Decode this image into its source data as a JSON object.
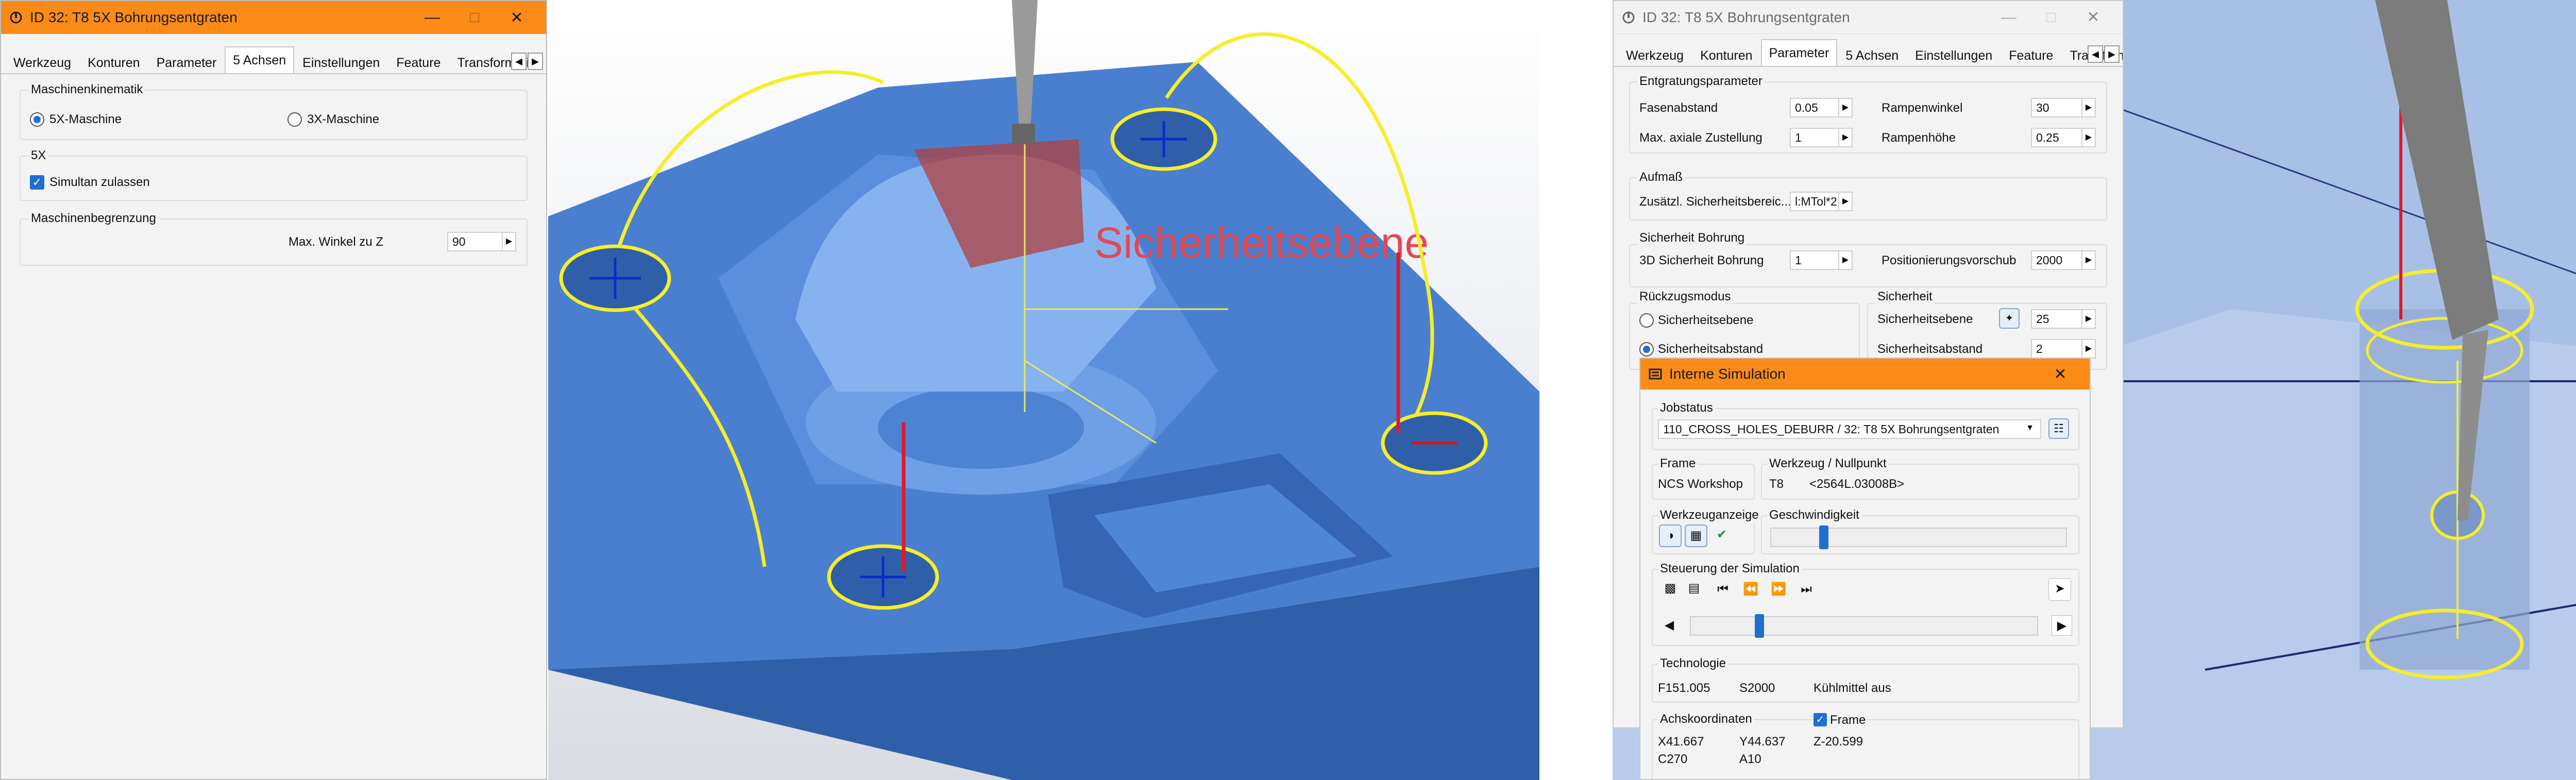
{
  "left_window": {
    "title": "ID 32: T8 5X Bohrungsentgraten",
    "tabs": [
      "Werkzeug",
      "Konturen",
      "Parameter",
      "5 Achsen",
      "Einstellungen",
      "Feature",
      "Transformatio"
    ],
    "active_tab": "5 Achsen",
    "kinematik": {
      "title": "Maschinenkinematik",
      "option_5x": "5X-Maschine",
      "option_3x": "3X-Maschine",
      "selected": "5X-Maschine"
    },
    "fivex": {
      "title": "5X",
      "simultan_label": "Simultan zulassen",
      "simultan_checked": true
    },
    "begrenzung": {
      "title": "Maschinenbegrenzung",
      "max_winkel_label": "Max. Winkel zu Z",
      "max_winkel_value": "90"
    }
  },
  "right_window": {
    "title": "ID 32: T8 5X Bohrungsentgraten",
    "tabs": [
      "Werkzeug",
      "Konturen",
      "Parameter",
      "5 Achsen",
      "Einstellungen",
      "Feature",
      "Transformati"
    ],
    "active_tab": "Parameter",
    "entgratung": {
      "title": "Entgratungsparameter",
      "fasenabstand_label": "Fasenabstand",
      "fasenabstand_value": "0.05",
      "rampenwinkel_label": "Rampenwinkel",
      "rampenwinkel_value": "30",
      "max_axiale_label": "Max. axiale Zustellung",
      "max_axiale_value": "1",
      "rampenhoehe_label": "Rampenhöhe",
      "rampenhoehe_value": "0.25"
    },
    "aufmass": {
      "title": "Aufmaß",
      "zus_label": "Zusätzl. Sicherheitsbereic...",
      "zus_value": "l:MTol*2"
    },
    "sicherheit_bohrung": {
      "title": "Sicherheit Bohrung",
      "sicherheit_label": "3D Sicherheit Bohrung",
      "sicherheit_value": "1",
      "vorschub_label": "Positionierungsvorschub",
      "vorschub_value": "2000"
    },
    "rueckzug": {
      "title": "Rückzugsmodus",
      "option_ebene": "Sicherheitsebene",
      "option_abstand": "Sicherheitsabstand",
      "selected": "Sicherheitsabstand"
    },
    "sicherheit": {
      "title": "Sicherheit",
      "ebene_label": "Sicherheitsebene",
      "ebene_value": "25",
      "abstand_label": "Sicherheitsabstand",
      "abstand_value": "2"
    }
  },
  "simulation": {
    "title": "Interne Simulation",
    "jobstatus_label": "Jobstatus",
    "jobstatus_value": "110_CROSS_HOLES_DEBURR / 32: T8 5X Bohrungsentgraten",
    "frame_label": "Frame",
    "frame_value": "NCS Workshop",
    "werkzeug_label": "Werkzeug / Nullpunkt",
    "werkzeug_value": "T8",
    "nullpunkt_value": "<2564L.03008B>",
    "werkzeuganzeige_label": "Werkzeuganzeige",
    "geschwindigkeit_label": "Geschwindigkeit",
    "geschwindigkeit_level": 0.18,
    "steuerung_label": "Steuerung der Simulation",
    "progress_level": 0.2,
    "technologie_label": "Technologie",
    "feed": "F151.005",
    "spindle": "S2000",
    "coolant": "Kühlmittel aus",
    "achs_label": "Achskoordinaten",
    "frame_check_label": "Frame",
    "frame_checked": true,
    "x": "X41.667",
    "y": "Y44.637",
    "z": "Z-20.599",
    "c": "C270",
    "a": "A10"
  },
  "viewport_left": {
    "annotation": "Sicherheitsebene"
  },
  "colors": {
    "accent": "#fa8b17",
    "selection": "#1f6fd1",
    "part": "#3f74c6",
    "toolpath": "#f5ee2a",
    "retract": "#e0192a"
  },
  "icons": [
    "app-icon",
    "minimize-icon",
    "maximize-icon",
    "close-icon",
    "tab-scroll-left-icon",
    "tab-scroll-right-icon",
    "tool-display-icon",
    "holder-display-icon",
    "stock-display-icon",
    "skip-start-icon",
    "skip-end-icon",
    "rewind-icon",
    "fast-forward-icon",
    "step-back-icon",
    "step-forward-icon",
    "cursor-icon",
    "picker-icon"
  ]
}
